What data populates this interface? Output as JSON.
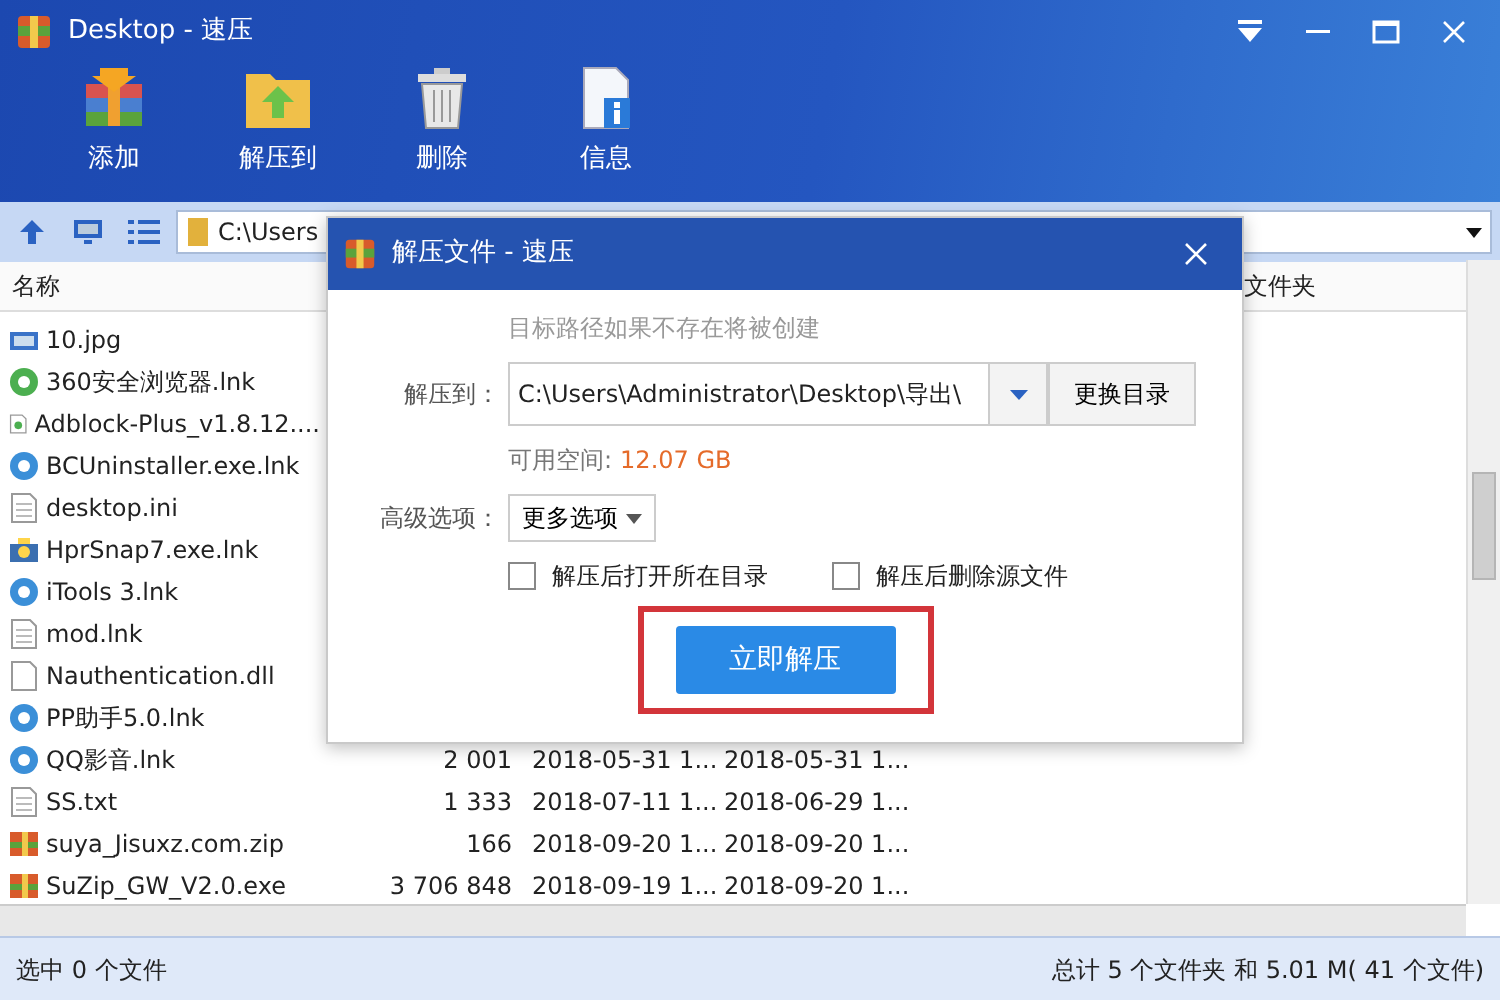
{
  "window": {
    "title": "Desktop - 速压"
  },
  "toolbar": [
    {
      "label": "添加",
      "kind": "add"
    },
    {
      "label": "解压到",
      "kind": "extract"
    },
    {
      "label": "删除",
      "kind": "delete"
    },
    {
      "label": "信息",
      "kind": "info"
    }
  ],
  "address_bar": {
    "path": "C:\\Users"
  },
  "table": {
    "columns": [
      "名称",
      "文件夹"
    ],
    "rows": [
      {
        "name": "10.jpg",
        "kind": "image"
      },
      {
        "name": "360安全浏览器.lnk",
        "kind": "browser"
      },
      {
        "name": "Adblock-Plus_v1.8.12....",
        "kind": "webfile"
      },
      {
        "name": "BCUninstaller.exe.lnk",
        "kind": "app"
      },
      {
        "name": "desktop.ini",
        "kind": "text"
      },
      {
        "name": "HprSnap7.exe.lnk",
        "kind": "camera"
      },
      {
        "name": "iTools 3.lnk",
        "kind": "app"
      },
      {
        "name": "mod.lnk",
        "kind": "text"
      },
      {
        "name": "Nauthentication.dll",
        "kind": "blank"
      },
      {
        "name": "PP助手5.0.lnk",
        "kind": "app"
      },
      {
        "name": "QQ影音.lnk",
        "kind": "app",
        "size": "2 001",
        "modified": "2018-05-31 1...",
        "created": "2018-05-31 1..."
      },
      {
        "name": "SS.txt",
        "kind": "text",
        "size": "1 333",
        "modified": "2018-07-11 1...",
        "created": "2018-06-29 1..."
      },
      {
        "name": "suya_Jisuxz.com.zip",
        "kind": "zip",
        "size": "166",
        "modified": "2018-09-20 1...",
        "created": "2018-09-20 1..."
      },
      {
        "name": "SuZip_GW_V2.0.exe",
        "kind": "zip",
        "size": "3 706 848",
        "modified": "2018-09-19 1...",
        "created": "2018-09-20 1..."
      }
    ]
  },
  "status_bar": {
    "left": "选中 0 个文件",
    "right": "总计 5 个文件夹 和 5.01 M( 41 个文件)"
  },
  "dialog": {
    "title": "解压文件 - 速压",
    "hint": "目标路径如果不存在将被创建",
    "target_label": "解压到：",
    "target_path": "C:\\Users\\Administrator\\Desktop\\导出\\",
    "change_button": "更换目录",
    "free_label": "可用空间:",
    "free_value": "12.07 GB",
    "advanced_label": "高级选项：",
    "advanced_button": "更多选项",
    "options": [
      {
        "label": "解压后打开所在目录",
        "checked": false
      },
      {
        "label": "解压后删除源文件",
        "checked": false
      }
    ],
    "primary_button": "立即解压",
    "highlighted": true
  }
}
